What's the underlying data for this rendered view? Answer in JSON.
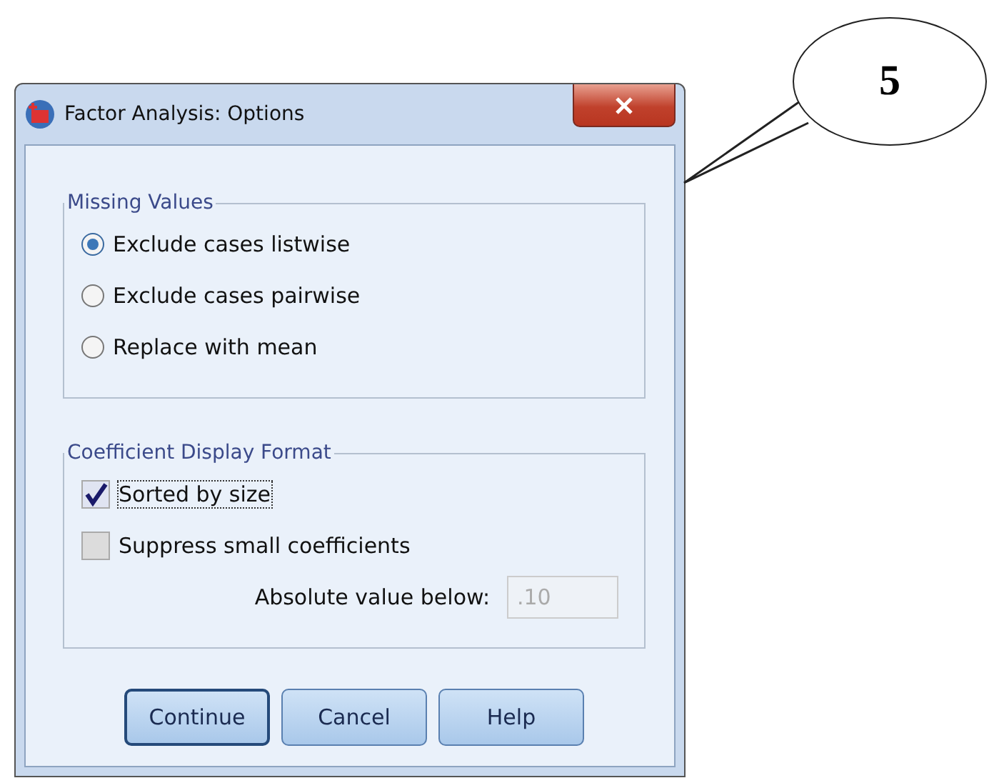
{
  "window": {
    "title": "Factor Analysis: Options"
  },
  "callout": {
    "label": "5"
  },
  "groups": [
    {
      "title": "Missing Values",
      "items": [
        {
          "kind": "radio",
          "label": "Exclude cases listwise",
          "selected": true
        },
        {
          "kind": "radio",
          "label": "Exclude cases pairwise",
          "selected": false
        },
        {
          "kind": "radio",
          "label": "Replace with mean",
          "selected": false
        }
      ]
    },
    {
      "title": "Coefficient Display Format",
      "items": [
        {
          "kind": "checkbox",
          "label": "Sorted by size",
          "checked": true,
          "focused": true
        },
        {
          "kind": "checkbox",
          "label": "Suppress small coefficients",
          "checked": false,
          "focused": false
        },
        {
          "kind": "field",
          "label": "Absolute value below:",
          "value": ".10",
          "disabled": true
        }
      ]
    }
  ],
  "buttons": [
    {
      "label": "Continue",
      "default": true
    },
    {
      "label": "Cancel",
      "default": false
    },
    {
      "label": "Help",
      "default": false
    }
  ]
}
